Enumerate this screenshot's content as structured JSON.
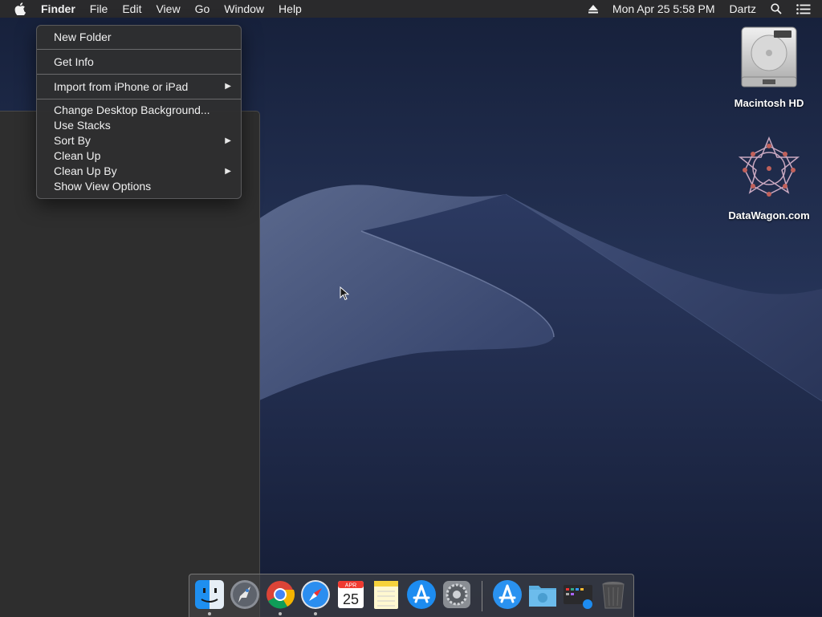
{
  "menubar": {
    "apple_icon": "apple-logo-icon",
    "app_name": "Finder",
    "menus": [
      "File",
      "Edit",
      "View",
      "Go",
      "Window",
      "Help"
    ],
    "datetime": "Mon Apr 25  5:58 PM",
    "user": "Dartz",
    "status_icons": [
      "eject-icon",
      "spotlight-search-icon",
      "notification-center-icon"
    ]
  },
  "context_menu": {
    "items": [
      {
        "label": "New Folder"
      },
      {
        "label": "Get Info"
      },
      {
        "label": "Import from iPhone or iPad",
        "submenu": true
      },
      {
        "label": "Change Desktop Background..."
      },
      {
        "label": "Use Stacks"
      },
      {
        "label": "Sort By",
        "submenu": true
      },
      {
        "label": "Clean Up"
      },
      {
        "label": "Clean Up By",
        "submenu": true
      },
      {
        "label": "Show View Options"
      }
    ]
  },
  "desktop_icons": [
    {
      "label": "Macintosh HD",
      "icon": "hard-drive-icon"
    },
    {
      "label": "DataWagon.com",
      "icon": "datawagon-disk-image-icon"
    }
  ],
  "dock": {
    "items": [
      {
        "name": "Finder",
        "icon": "finder-icon",
        "running": true
      },
      {
        "name": "Launchpad",
        "icon": "launchpad-icon",
        "running": false
      },
      {
        "name": "Google Chrome",
        "icon": "chrome-icon",
        "running": true
      },
      {
        "name": "Safari",
        "icon": "safari-icon",
        "running": true
      },
      {
        "name": "Calendar",
        "icon": "calendar-icon",
        "running": false,
        "month": "APR",
        "day": "25"
      },
      {
        "name": "Notes",
        "icon": "notes-icon",
        "running": false
      },
      {
        "name": "App Store",
        "icon": "app-store-icon",
        "running": false
      },
      {
        "name": "System Preferences",
        "icon": "system-preferences-icon",
        "running": false
      },
      {
        "name": "Applications",
        "icon": "applications-folder-icon",
        "running": false
      },
      {
        "name": "Downloads",
        "icon": "downloads-folder-icon",
        "running": false
      },
      {
        "name": "Recent",
        "icon": "recent-stack-icon",
        "running": false
      },
      {
        "name": "Trash",
        "icon": "trash-icon",
        "running": false
      }
    ]
  },
  "colors": {
    "menubar_bg": "#2a2a2c",
    "menu_bg": "#2e2e30",
    "desktop_sky": "#1e2a48",
    "dune": "#2e3a5e"
  }
}
